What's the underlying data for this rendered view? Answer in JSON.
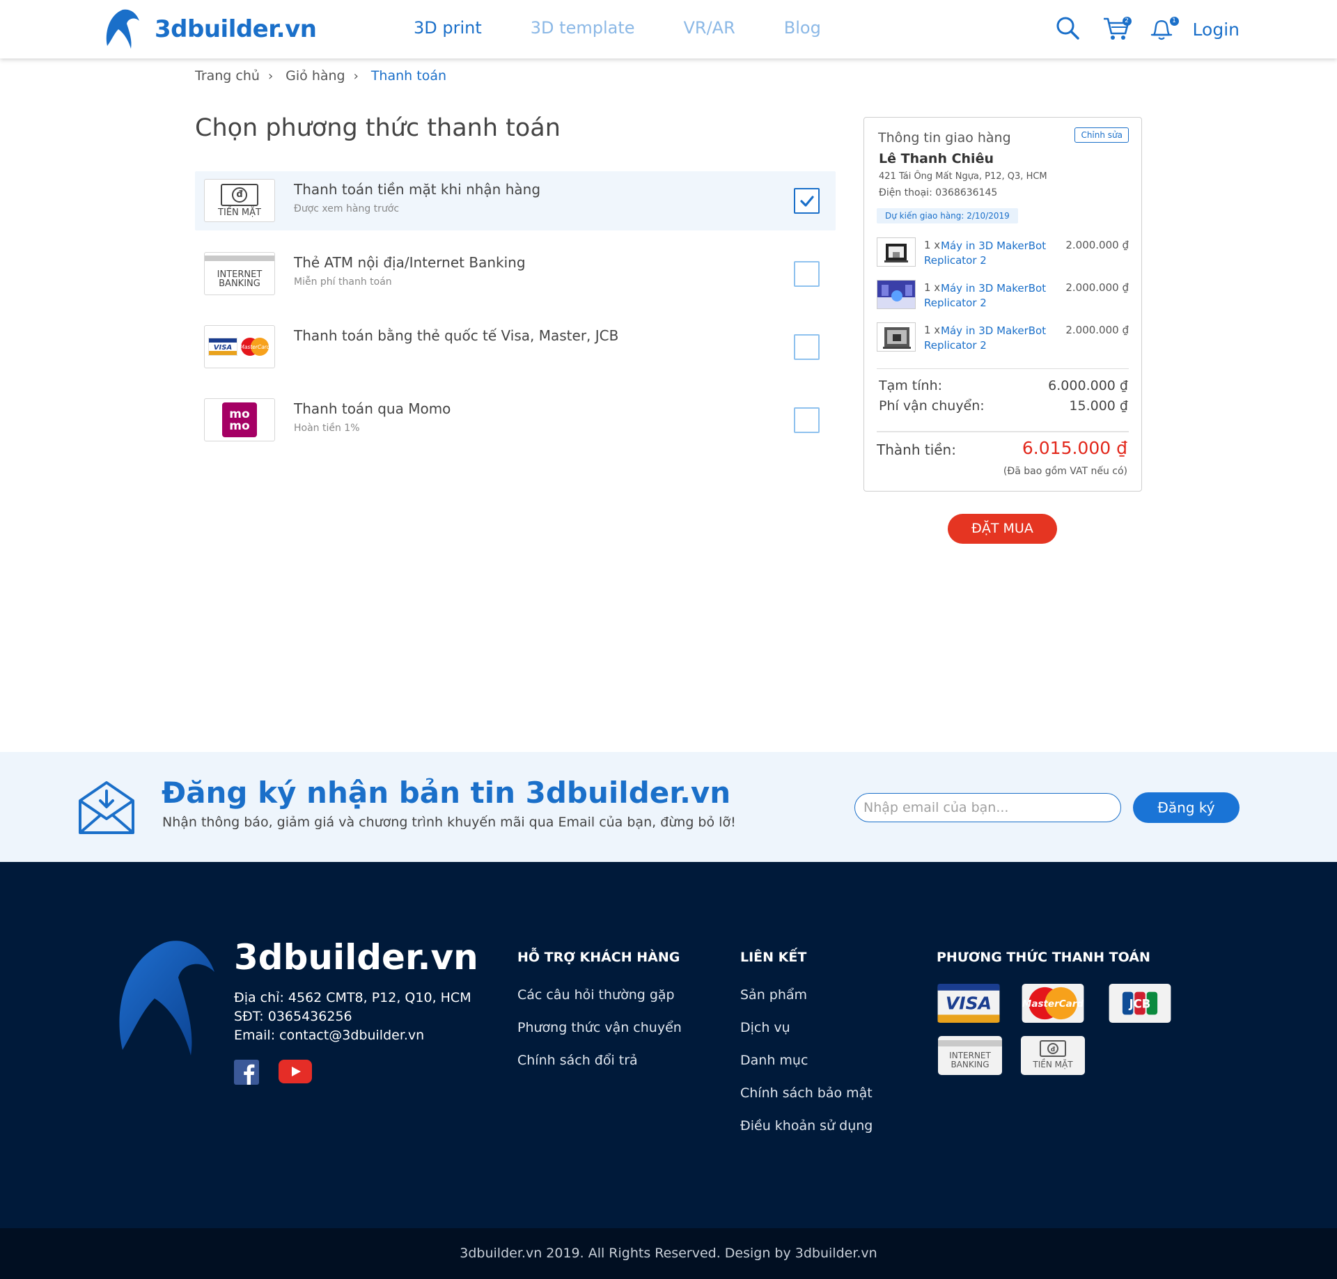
{
  "header": {
    "brand": "3dbuilder.vn",
    "nav": [
      {
        "label": "3D print"
      },
      {
        "label": "3D template"
      },
      {
        "label": "VR/AR"
      },
      {
        "label": "Blog"
      }
    ],
    "cart_count": "2",
    "notif_count": "1",
    "login_label": "Login"
  },
  "breadcrumb": [
    "Trang chủ",
    "Giỏ hàng",
    "Thanh toán"
  ],
  "page_title": "Chọn phương thức thanh toán",
  "payment_methods": [
    {
      "logo_caption": "TIỀN MẶT",
      "title": "Thanh toán tiền mặt khi nhận hàng",
      "subtitle": "Được xem hàng trước",
      "checked": true
    },
    {
      "logo_caption": "INTERNET BANKING",
      "title": "Thẻ ATM nội địa/Internet Banking",
      "subtitle": "Miễn phí thanh toán",
      "checked": false
    },
    {
      "logo_caption": "",
      "title": "Thanh toán bằng thẻ quốc tế Visa, Master, JCB",
      "subtitle": "",
      "checked": false
    },
    {
      "logo_caption": "",
      "title": "Thanh toán qua Momo",
      "subtitle": "Hoàn tiền 1%",
      "checked": false
    }
  ],
  "summary": {
    "heading": "Thông tin giao hàng",
    "edit_label": "Chỉnh sửa",
    "name": "Lê Thanh Chiêu",
    "address": "421 Tái Ông Mất Ngựa, P12, Q3, HCM",
    "phone": "Điện thoại: 0368636145",
    "eta": "Dự kiến giao hàng: 2/10/2019",
    "items": [
      {
        "qty": "1 x",
        "name": "Máy in 3D MakerBot Replicator 2",
        "price": "2.000.000 ₫"
      },
      {
        "qty": "1 x",
        "name": "Máy in 3D MakerBot Replicator 2",
        "price": "2.000.000 ₫"
      },
      {
        "qty": "1 x",
        "name": "Máy in 3D MakerBot Replicator 2",
        "price": "2.000.000 ₫"
      }
    ],
    "subtotal_label": "Tạm tính:",
    "subtotal": "6.000.000 ₫",
    "shipping_label": "Phí vận chuyển:",
    "shipping": "15.000 ₫",
    "total_label": "Thành tiền:",
    "total": "6.015.000 ₫",
    "vat_note": "(Đã bao gồm VAT nếu có)"
  },
  "order_button": "ĐẶT MUA",
  "newsletter": {
    "title": "Đăng ký nhận bản tin 3dbuilder.vn",
    "subtitle": "Nhận thông báo, giảm giá và chương trình khuyến mãi qua Email của bạn, đừng bỏ lỡ!",
    "placeholder": "Nhập email của bạn...",
    "button": "Đăng ký"
  },
  "footer": {
    "brand": "3dbuilder.vn",
    "address": "Địa chỉ: 4562 CMT8, P12, Q10, HCM",
    "phone": "SĐT: 0365436256",
    "email": "Email: contact@3dbuilder.vn",
    "support_title": "HỖ TRỢ KHÁCH HÀNG",
    "support_links": [
      "Các câu hỏi thường gặp",
      "Phương thức vận chuyển",
      "Chính sách đổi trả"
    ],
    "links_title": "LIÊN KẾT",
    "links": [
      "Sản phẩm",
      "Dịch vụ",
      "Danh mục",
      "Chính sách bảo mật",
      "Điều khoản sử dụng"
    ],
    "payments_title": "PHƯƠNG THỨC THANH TOÁN",
    "card_labels": {
      "visa": "VISA",
      "mastercard": "MasterCard",
      "jcb": "JCB",
      "banking": "INTERNET BANKING",
      "cash": "TIỀN MẶT"
    },
    "copyright": "3dbuilder.vn 2019. All Rights Reserved. Design by 3dbuilder.vn"
  },
  "colors": {
    "brand_blue": "#1a6fc9",
    "accent_red": "#e53522",
    "footer_bg": "#001a3a"
  }
}
